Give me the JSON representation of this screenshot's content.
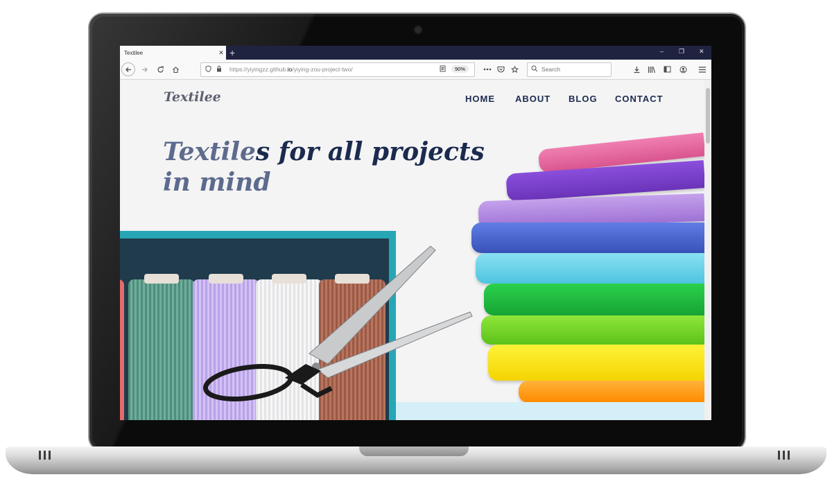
{
  "browser": {
    "tab_title": "Textilee",
    "tab_close": "✕",
    "new_tab": "+",
    "window_controls": [
      "–",
      "❐",
      "✕"
    ],
    "url_prefix": "https://yiyingzz.github.",
    "url_host_tail": "io",
    "url_path": "/yiying-zou-project-two/",
    "zoom": "90%",
    "search_placeholder": "Search",
    "icons": [
      "back-icon",
      "forward-icon",
      "reload-icon",
      "home-icon",
      "shield-icon",
      "lock-icon",
      "reader-icon",
      "more-icon",
      "pocket-icon",
      "star-icon",
      "search-icon",
      "download-icon",
      "library-icon",
      "sidebar-icon",
      "account-icon",
      "menu-icon"
    ]
  },
  "site": {
    "logo": "Textilee",
    "nav": [
      "HOME",
      "ABOUT",
      "BLOG",
      "CONTACT"
    ],
    "hero_line1_fade": "Textile",
    "hero_line1_rest": "s for all projects",
    "hero_line2": "in mind"
  },
  "colors": {
    "navy": "#1b2a4e",
    "teal": "#27a6b6",
    "panel": "#203b4c",
    "background": "#f4f4f5"
  }
}
